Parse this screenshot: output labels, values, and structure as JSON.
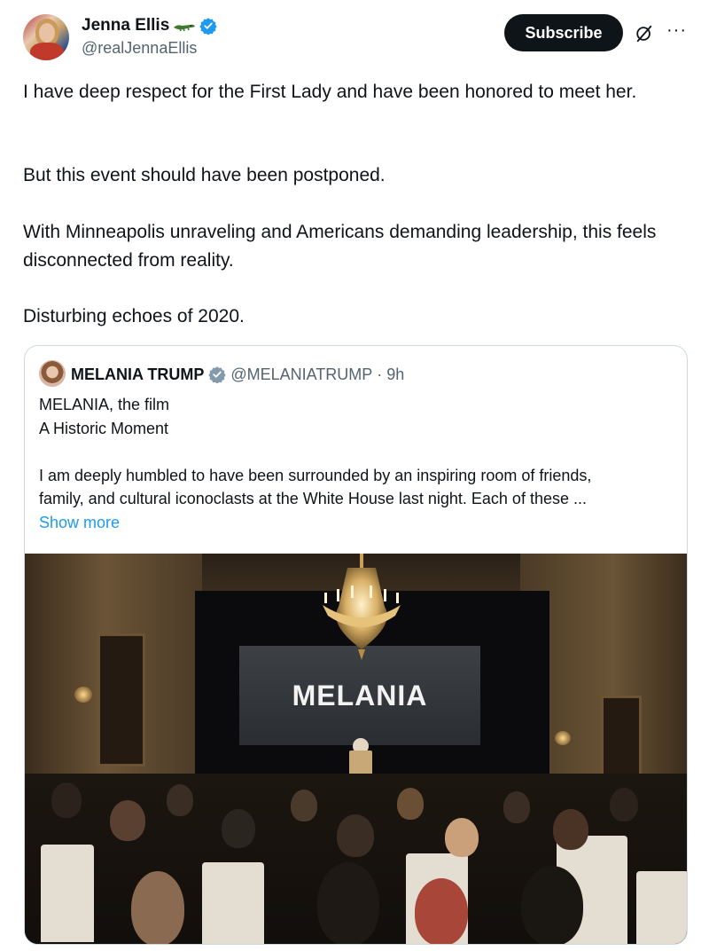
{
  "author": {
    "display_name": "Jenna Ellis",
    "handle": "@realJennaEllis",
    "emoji_icon": "crocodile-icon",
    "verified_icon": "verified-badge-icon"
  },
  "actions": {
    "subscribe_label": "Subscribe",
    "grok_icon": "grok-icon",
    "more_icon": "more-horizontal-icon",
    "more_glyph": "···"
  },
  "tweet": {
    "paragraphs": [
      "I have deep respect for the First Lady and have been honored to meet her.",
      "But this event should have been postponed.",
      "With Minneapolis unraveling and Americans demanding leadership, this feels disconnected from reality.",
      "Disturbing echoes of 2020."
    ]
  },
  "quoted": {
    "display_name": "MELANIA TRUMP",
    "handle": "@MELANIATRUMP",
    "separator": "·",
    "time": "9h",
    "lines": [
      "MELANIA, the film",
      "A Historic Moment",
      "I am deeply humbled to have been surrounded by an inspiring room of friends,",
      "family, and cultural iconoclasts at the White House last night.  Each of these ..."
    ],
    "show_more_label": "Show more",
    "media": {
      "screen_text": "MELANIA"
    }
  },
  "colors": {
    "text_primary": "#0f1419",
    "text_secondary": "#536471",
    "link": "#1d9bf0",
    "verified": "#1d9bf0",
    "border": "#cfd9de"
  }
}
